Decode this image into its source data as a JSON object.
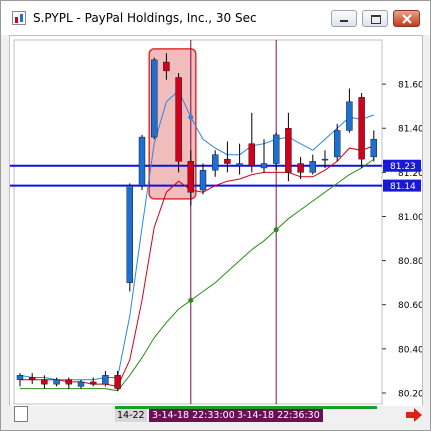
{
  "window": {
    "title": "S.PYPL - PayPal Holdings, Inc., 30 Sec",
    "buttons": [
      "minimize",
      "maximize",
      "close"
    ]
  },
  "time_labels": {
    "left": "14-22",
    "second": "3-14-18 22:33:00",
    "third": "3-14-18 22:36:30"
  },
  "colors": {
    "up": "#1f6fd0",
    "down": "#d0021b",
    "level_line": "#1010e0",
    "highlight": "#e06a6a",
    "vline": "#7a1050",
    "ma_blue": "#2f86e0",
    "ma_red": "#d0021b",
    "ma_green": "#2e8b1a"
  },
  "chart_data": {
    "type": "candlestick",
    "title": "S.PYPL - PayPal Holdings, Inc., 30 Sec",
    "ylim": [
      80.15,
      81.8
    ],
    "yticks": [
      81.6,
      81.4,
      81.2,
      81.0,
      80.8,
      80.6,
      80.4,
      80.2
    ],
    "price_lines": [
      {
        "label": "81.23",
        "value": 81.23
      },
      {
        "label": "81.14",
        "value": 81.14
      }
    ],
    "candles": [
      {
        "o": 80.26,
        "h": 80.29,
        "c": 80.28,
        "l": 80.23
      },
      {
        "o": 80.27,
        "h": 80.29,
        "c": 80.26,
        "l": 80.24
      },
      {
        "o": 80.26,
        "h": 80.28,
        "c": 80.24,
        "l": 80.22
      },
      {
        "o": 80.24,
        "h": 80.27,
        "c": 80.26,
        "l": 80.23
      },
      {
        "o": 80.26,
        "h": 80.27,
        "c": 80.24,
        "l": 80.22
      },
      {
        "o": 80.23,
        "h": 80.26,
        "c": 80.25,
        "l": 80.22
      },
      {
        "o": 80.25,
        "h": 80.27,
        "c": 80.24,
        "l": 80.23
      },
      {
        "o": 80.24,
        "h": 80.3,
        "c": 80.28,
        "l": 80.23
      },
      {
        "o": 80.28,
        "h": 80.3,
        "c": 80.22,
        "l": 80.21
      },
      {
        "o": 80.7,
        "h": 81.15,
        "c": 81.14,
        "l": 80.66
      },
      {
        "o": 81.14,
        "h": 81.37,
        "c": 81.36,
        "l": 81.12
      },
      {
        "o": 81.36,
        "h": 81.72,
        "c": 81.71,
        "l": 81.35
      },
      {
        "o": 81.7,
        "h": 81.74,
        "c": 81.66,
        "l": 81.62
      },
      {
        "o": 81.63,
        "h": 81.65,
        "c": 81.25,
        "l": 81.2
      },
      {
        "o": 81.25,
        "h": 81.3,
        "c": 81.11,
        "l": 81.05
      },
      {
        "o": 81.12,
        "h": 81.24,
        "c": 81.21,
        "l": 81.1
      },
      {
        "o": 81.21,
        "h": 81.3,
        "c": 81.28,
        "l": 81.18
      },
      {
        "o": 81.26,
        "h": 81.34,
        "c": 81.24,
        "l": 81.2
      },
      {
        "o": 81.23,
        "h": 81.33,
        "c": 81.24,
        "l": 81.19
      },
      {
        "o": 81.33,
        "h": 81.47,
        "c": 81.23,
        "l": 81.2
      },
      {
        "o": 81.22,
        "h": 81.35,
        "c": 81.24,
        "l": 81.2
      },
      {
        "o": 81.24,
        "h": 81.38,
        "c": 81.37,
        "l": 81.21
      },
      {
        "o": 81.4,
        "h": 81.47,
        "c": 81.2,
        "l": 81.16
      },
      {
        "o": 81.24,
        "h": 81.27,
        "c": 81.2,
        "l": 81.17
      },
      {
        "o": 81.2,
        "h": 81.28,
        "c": 81.25,
        "l": 81.19
      },
      {
        "o": 81.26,
        "h": 81.3,
        "c": 81.26,
        "l": 81.22
      },
      {
        "o": 81.27,
        "h": 81.42,
        "c": 81.39,
        "l": 81.25
      },
      {
        "o": 81.39,
        "h": 81.58,
        "c": 81.52,
        "l": 81.38
      },
      {
        "o": 81.54,
        "h": 81.56,
        "c": 81.26,
        "l": 81.22
      },
      {
        "o": 81.27,
        "h": 81.39,
        "c": 81.35,
        "l": 81.25
      }
    ],
    "moving_averages": [
      {
        "color": "blue",
        "values": [
          80.28,
          80.27,
          80.27,
          80.26,
          80.26,
          80.26,
          80.26,
          80.27,
          80.27,
          80.55,
          80.95,
          81.33,
          81.52,
          81.57,
          81.45,
          81.35,
          81.31,
          81.28,
          81.28,
          81.32,
          81.33,
          81.35,
          81.36,
          81.33,
          81.3,
          81.35,
          81.4,
          81.45,
          81.44,
          81.46
        ]
      },
      {
        "color": "red",
        "values": [
          80.26,
          80.26,
          80.26,
          80.26,
          80.25,
          80.25,
          80.24,
          80.24,
          80.23,
          80.35,
          80.62,
          80.95,
          81.11,
          81.16,
          81.12,
          81.11,
          81.14,
          81.16,
          81.17,
          81.19,
          81.2,
          81.2,
          81.2,
          81.18,
          81.18,
          81.21,
          81.25,
          81.31,
          81.3,
          81.32
        ]
      },
      {
        "color": "green",
        "values": [
          80.22,
          80.22,
          80.22,
          80.22,
          80.22,
          80.22,
          80.22,
          80.22,
          80.21,
          80.28,
          80.36,
          80.45,
          80.52,
          80.58,
          80.62,
          80.66,
          80.7,
          80.75,
          80.8,
          80.85,
          80.89,
          80.94,
          80.99,
          81.03,
          81.07,
          81.11,
          81.15,
          81.19,
          81.22,
          81.26
        ]
      }
    ],
    "vlines": [
      14,
      21
    ],
    "highlight": {
      "from": 11,
      "to": 14
    }
  }
}
